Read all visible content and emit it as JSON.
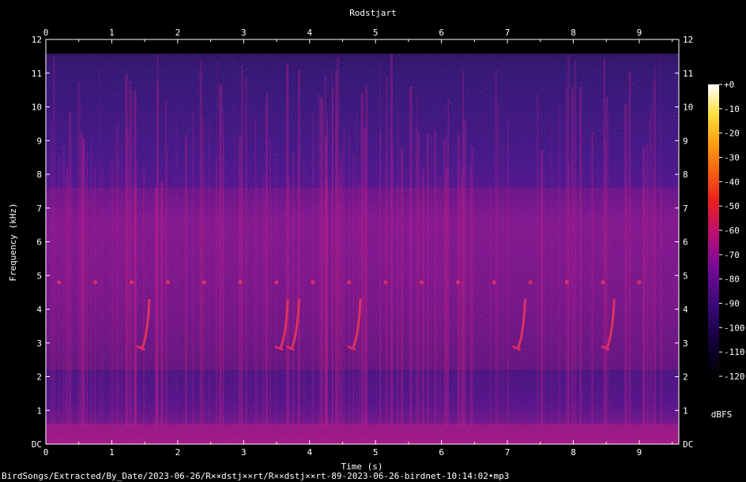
{
  "chart_data": {
    "type": "heatmap",
    "title": "Rodstjart",
    "xlabel": "Time (s)",
    "ylabel": "Frequency (kHz)",
    "xlim": [
      0,
      9.6
    ],
    "ylim": [
      0,
      12
    ],
    "x_ticks": [
      "0",
      "1",
      "2",
      "3",
      "4",
      "5",
      "6",
      "7",
      "8",
      "9"
    ],
    "y_ticks": [
      "DC",
      "1",
      "2",
      "3",
      "4",
      "5",
      "6",
      "7",
      "8",
      "9",
      "10",
      "11",
      "12"
    ],
    "colorbar": {
      "label": "dBFS",
      "range": [
        -120,
        0
      ],
      "ticks": [
        "+0",
        "-10",
        "-20",
        "-30",
        "-40",
        "-50",
        "-60",
        "-70",
        "-80",
        "-90",
        "-100",
        "-110",
        "-120"
      ],
      "colors": [
        "#000000",
        "#1a0050",
        "#4b0a80",
        "#8a0a9a",
        "#c0106a",
        "#e8201e",
        "#f86010",
        "#fca010",
        "#ffe040",
        "#ffffff"
      ]
    },
    "song_phrase_times_s": [
      1.45,
      3.55,
      3.72,
      4.65,
      7.15,
      8.5
    ],
    "song_band_khz": [
      2.8,
      4.3
    ],
    "harmonic_band_khz": 4.8
  },
  "caption": "BirdSongs/Extracted/By_Date/2023-06-26/R××dstj××rt/R××dstj××rt-89-2023-06-26-birdnet-10:14:02•mp3"
}
